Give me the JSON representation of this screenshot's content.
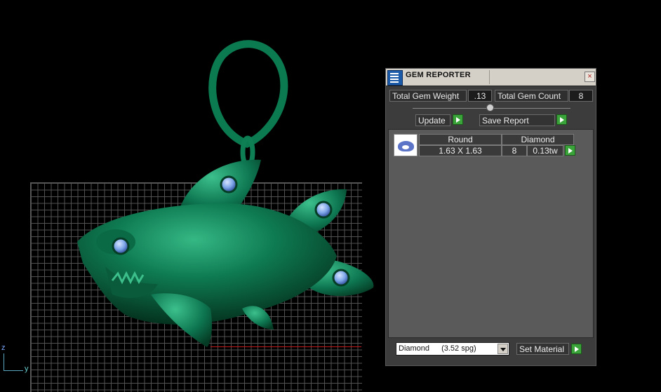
{
  "viewport": {
    "axis_labels": {
      "z": "z",
      "y": "y"
    },
    "model": {
      "name": "shark-pendant",
      "body_color": "#0e7a52",
      "gem_color": "#7ea6e8",
      "gem_count_visible": 4
    }
  },
  "gem_reporter": {
    "title": "GEM REPORTER",
    "close_symbol": "×",
    "total_weight_label": "Total Gem Weight",
    "total_weight_value": ".13",
    "total_count_label": "Total Gem Count",
    "total_count_value": "8",
    "update_label": "Update",
    "save_report_label": "Save Report",
    "table": {
      "header_shape": "Round",
      "header_material": "Diamond",
      "size": "1.63 X 1.63",
      "count": "8",
      "weight": "0.13tw"
    },
    "material_select": {
      "value": "Diamond",
      "spg": "(3.52 spg)"
    },
    "set_material_label": "Set Material",
    "colors": {
      "go_button": "#3aa33a",
      "panel_bg": "#3c3c3c",
      "titlebar": "#d4d0c8"
    }
  }
}
